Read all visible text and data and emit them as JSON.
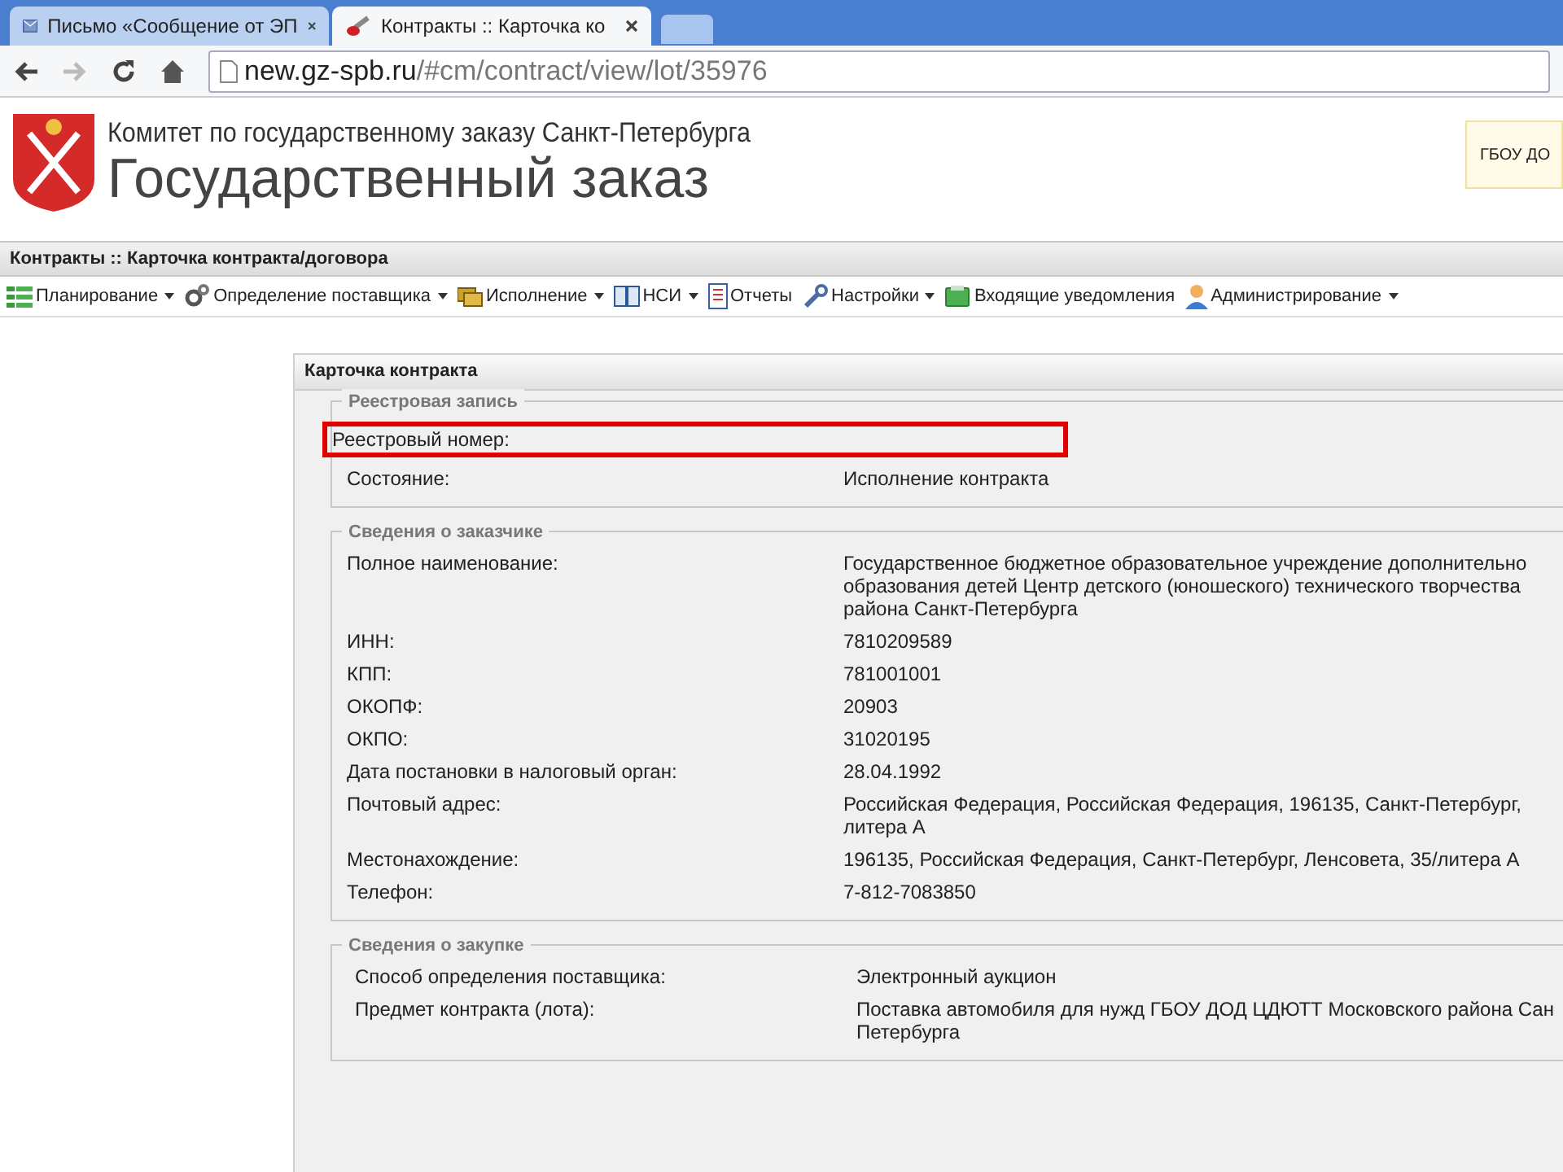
{
  "browser": {
    "tabs": [
      {
        "title": "Письмо «Сообщение от ЭП",
        "selected": false
      },
      {
        "title": "Контракты :: Карточка ко",
        "selected": true
      }
    ],
    "url": {
      "host": "new.gz-spb.ru",
      "path": "/#cm/contract/view/lot/35976"
    }
  },
  "header": {
    "org": "Комитет по государственному заказу Санкт-Петербурга",
    "title": "Государственный заказ",
    "user_box": "ГБОУ ДО"
  },
  "page_title": "Контракты :: Карточка контракта/договора",
  "menu": [
    {
      "label": "Планирование",
      "dropdown": true
    },
    {
      "label": "Определение поставщика",
      "dropdown": true
    },
    {
      "label": "Исполнение",
      "dropdown": true
    },
    {
      "label": "НСИ",
      "dropdown": true
    },
    {
      "label": "Отчеты",
      "dropdown": false
    },
    {
      "label": "Настройки",
      "dropdown": true
    },
    {
      "label": "Входящие уведомления",
      "dropdown": false
    },
    {
      "label": "Администрирование",
      "dropdown": true
    }
  ],
  "card": {
    "title": "Карточка контракта",
    "sections": [
      {
        "legend": "Реестровая запись",
        "rows": [
          {
            "label": "Реестровый номер:",
            "value": [],
            "highlighted": true
          },
          {
            "label": "Состояние:",
            "value": [
              "Исполнение контракта"
            ],
            "highlighted": false
          }
        ]
      },
      {
        "legend": "Сведения о заказчике",
        "rows": [
          {
            "label": "Полное наименование:",
            "value": [
              "Государственное бюджетное образовательное учреждение дополнительно",
              "образования детей Центр детского (юношеского) технического творчества",
              "района Санкт-Петербурга"
            ],
            "highlighted": false
          },
          {
            "label": "ИНН:",
            "value": [
              "7810209589"
            ],
            "highlighted": false
          },
          {
            "label": "КПП:",
            "value": [
              "781001001"
            ],
            "highlighted": false
          },
          {
            "label": "ОКОПФ:",
            "value": [
              "20903"
            ],
            "highlighted": false
          },
          {
            "label": "ОКПО:",
            "value": [
              "31020195"
            ],
            "highlighted": false
          },
          {
            "label": "Дата постановки в налоговый орган:",
            "value": [
              "28.04.1992"
            ],
            "highlighted": false
          },
          {
            "label": "Почтовый адрес:",
            "value": [
              "Российская Федерация, Российская Федерация, 196135, Санкт-Петербург,",
              "литера А"
            ],
            "highlighted": false
          },
          {
            "label": "Местонахождение:",
            "value": [
              "196135, Российская Федерация, Санкт-Петербург, Ленсовета, 35/литера А"
            ],
            "highlighted": false
          },
          {
            "label": "Телефон:",
            "value": [
              "7-812-7083850"
            ],
            "highlighted": false
          }
        ]
      },
      {
        "legend": "Сведения о закупке",
        "rows": [
          {
            "label": "Способ определения поставщика:",
            "value": [
              "Электронный аукцион"
            ],
            "highlighted": false
          },
          {
            "label": "Предмет контракта (лота):",
            "value": [
              "Поставка автомобиля для нужд ГБОУ ДОД ЦДЮТТ Московского района Сан",
              "Петербурга"
            ],
            "highlighted": false
          }
        ]
      }
    ]
  }
}
